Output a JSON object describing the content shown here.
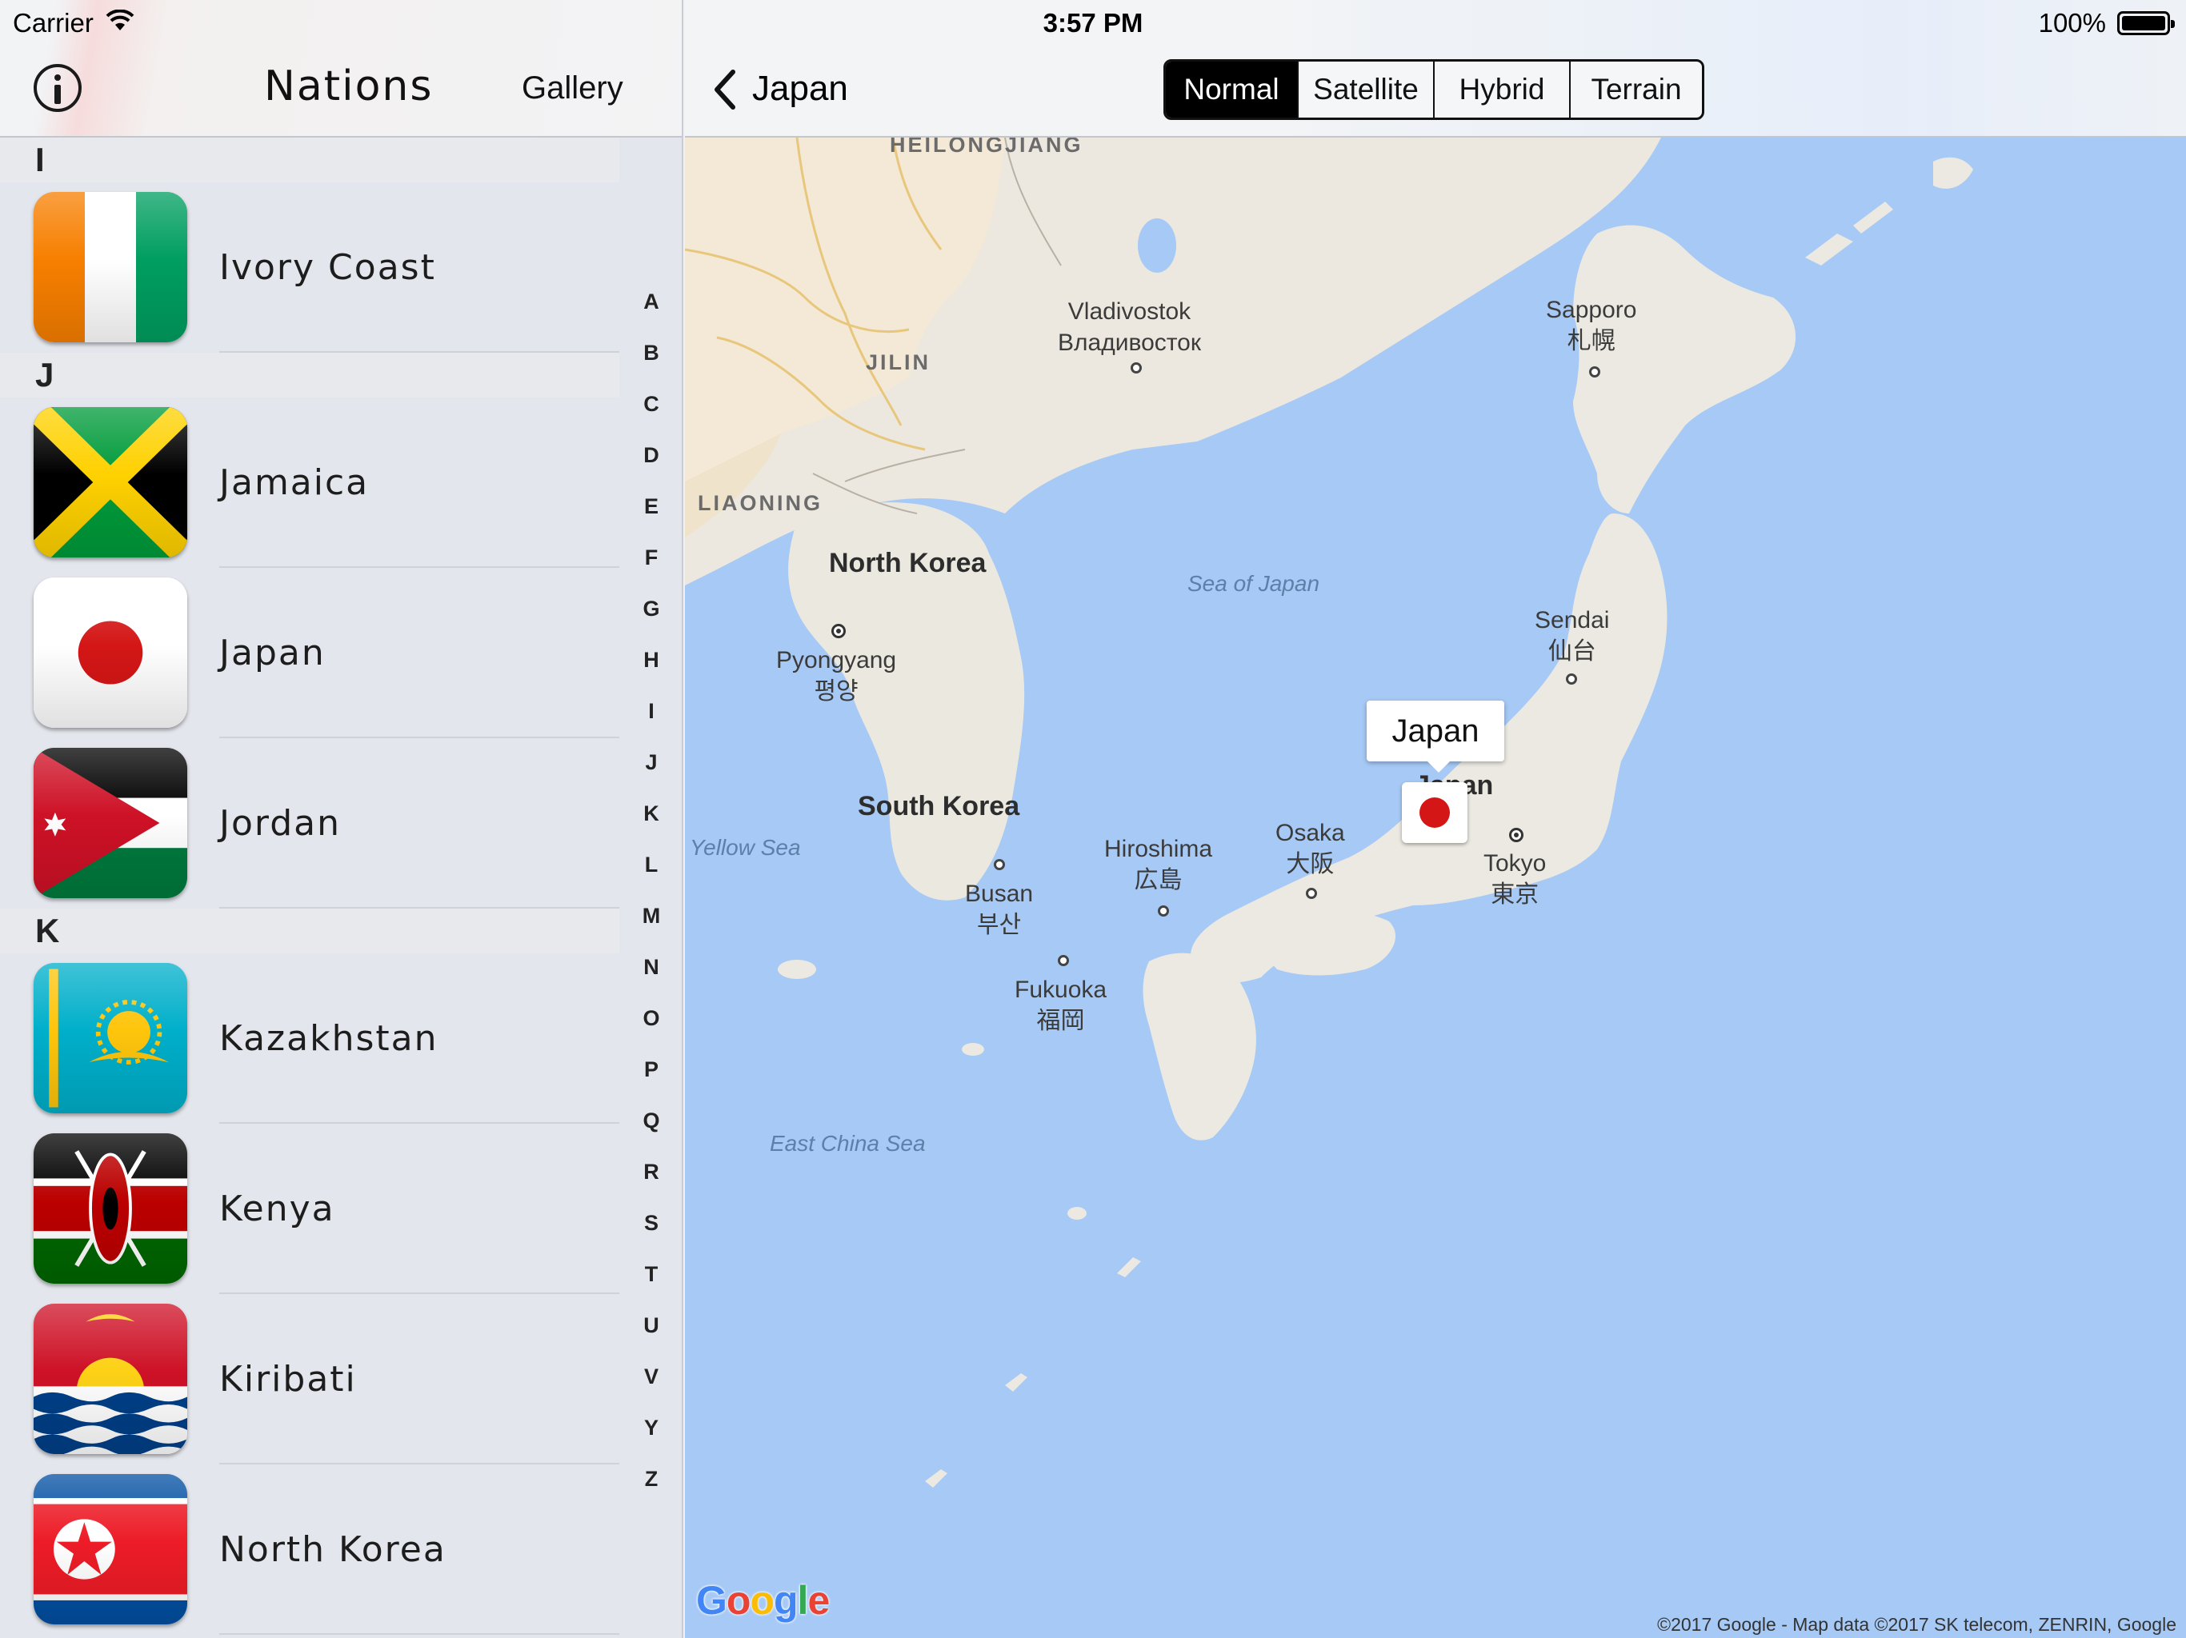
{
  "status_bar": {
    "carrier": "Carrier",
    "time": "3:57 PM",
    "battery": "100%"
  },
  "left_nav": {
    "title": "Nations",
    "gallery_label": "Gallery"
  },
  "sections": [
    {
      "letter": "I",
      "rows": [
        {
          "name": "Ivory Coast",
          "flag": "ivory-coast"
        }
      ]
    },
    {
      "letter": "J",
      "rows": [
        {
          "name": "Jamaica",
          "flag": "jamaica"
        },
        {
          "name": "Japan",
          "flag": "japan"
        },
        {
          "name": "Jordan",
          "flag": "jordan"
        }
      ]
    },
    {
      "letter": "K",
      "rows": [
        {
          "name": "Kazakhstan",
          "flag": "kazakhstan"
        },
        {
          "name": "Kenya",
          "flag": "kenya"
        },
        {
          "name": "Kiribati",
          "flag": "kiribati"
        },
        {
          "name": "North Korea",
          "flag": "north-korea"
        }
      ]
    }
  ],
  "index_letters": [
    "A",
    "B",
    "C",
    "D",
    "E",
    "F",
    "G",
    "H",
    "I",
    "J",
    "K",
    "L",
    "M",
    "N",
    "O",
    "P",
    "Q",
    "R",
    "S",
    "T",
    "U",
    "V",
    "Y",
    "Z"
  ],
  "right_nav": {
    "back_label": "Japan",
    "map_types": [
      "Normal",
      "Satellite",
      "Hybrid",
      "Terrain"
    ],
    "selected_map_type": "Normal"
  },
  "map": {
    "callout": "Japan",
    "regions": [
      "HEILONGJIANG",
      "JILIN",
      "LIAONING"
    ],
    "countries": [
      "North Korea",
      "South Korea",
      "Japan"
    ],
    "seas": [
      "Sea of Japan",
      "Yellow Sea",
      "East China Sea"
    ],
    "cities": {
      "vladivostok": [
        "Vladivostok",
        "Владивосток"
      ],
      "sapporo": [
        "Sapporo",
        "札幌"
      ],
      "sendai": [
        "Sendai",
        "仙台"
      ],
      "pyongyang": [
        "Pyongyang",
        "평양"
      ],
      "hiroshima": [
        "Hiroshima",
        "広島"
      ],
      "osaka": [
        "Osaka",
        "大阪"
      ],
      "tokyo": [
        "Tokyo",
        "東京"
      ],
      "busan": [
        "Busan",
        "부산"
      ],
      "fukuoka": [
        "Fukuoka",
        "福岡"
      ]
    },
    "logo": "Google",
    "attribution": "©2017 Google - Map data ©2017 SK telecom, ZENRIN, Google"
  },
  "colors": {
    "selected_segment": "#000000",
    "water": "#a6c9f5",
    "land": "#eceae3",
    "japan_red": "#d41616"
  }
}
